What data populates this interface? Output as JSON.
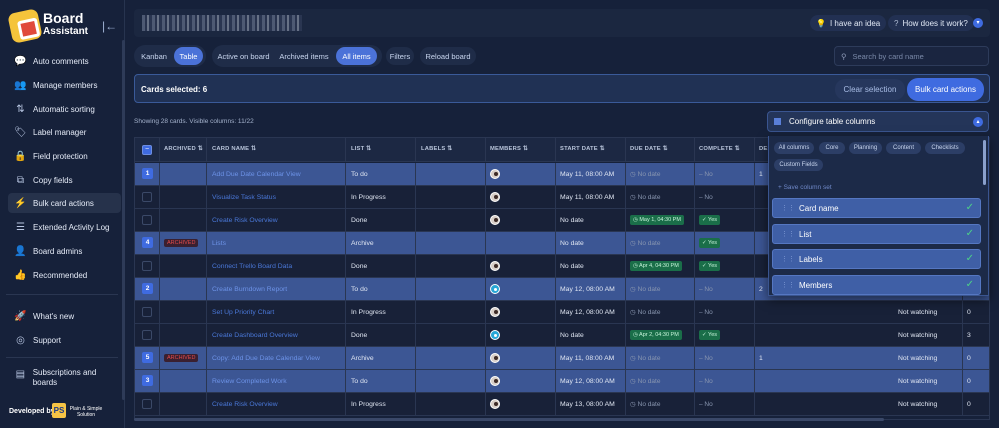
{
  "brand": {
    "name": "Board",
    "sub": "Assistant"
  },
  "sidebar": {
    "items": [
      {
        "label": "Auto comments",
        "icon": "chat-icon",
        "glyph": "💬"
      },
      {
        "label": "Manage members",
        "icon": "users-icon",
        "glyph": "👥"
      },
      {
        "label": "Automatic sorting",
        "icon": "sort-icon",
        "glyph": "⇅"
      },
      {
        "label": "Label manager",
        "icon": "label-icon",
        "glyph": "🏷"
      },
      {
        "label": "Field protection",
        "icon": "lock-icon",
        "glyph": "🔒"
      },
      {
        "label": "Copy fields",
        "icon": "copy-icon",
        "glyph": "⧉"
      },
      {
        "label": "Bulk card actions",
        "icon": "bulk-icon",
        "glyph": "⚡"
      },
      {
        "label": "Extended Activity Log",
        "icon": "log-icon",
        "glyph": "☰"
      },
      {
        "label": "Board admins",
        "icon": "admin-icon",
        "glyph": "👤"
      },
      {
        "label": "Recommended",
        "icon": "thumbs-up-icon",
        "glyph": "👍"
      }
    ],
    "secondary": [
      {
        "label": "What's new",
        "icon": "rocket-icon",
        "glyph": "🚀"
      },
      {
        "label": "Support",
        "icon": "support-icon",
        "glyph": "◎"
      }
    ],
    "subscriptions": {
      "label": "Subscriptions and boards",
      "icon": "subscription-icon",
      "glyph": "▤"
    },
    "developed_by": "Developed by",
    "ps_logo": "PS",
    "ps_name": "Plain & Simple Solution"
  },
  "topbar": {
    "idea_label": "I have an idea",
    "how_label": "How does it work?"
  },
  "toolbar": {
    "views": [
      "Kanban",
      "Table"
    ],
    "filters": [
      "Active on board",
      "Archived items",
      "All items"
    ],
    "filters_label": "Filters",
    "reload_label": "Reload board",
    "search_placeholder": "Search by card name"
  },
  "selection": {
    "count_label": "Cards selected: 6",
    "clear_label": "Clear selection",
    "bulk_label": "Bulk card actions"
  },
  "showing": "Showing 28 cards. Visible columns: 11/22",
  "configure": {
    "label": "Configure table columns",
    "tabs": [
      "All columns",
      "Core",
      "Planning",
      "Content",
      "Checklists",
      "Custom Fields"
    ],
    "save_label": "+ Save column set",
    "columns": [
      "Card name",
      "List",
      "Labels",
      "Members"
    ]
  },
  "table": {
    "headers": [
      "ARCHIVED",
      "CARD NAME",
      "LIST",
      "LABELS",
      "MEMBERS",
      "START DATE",
      "DUE DATE",
      "COMPLETE",
      "DES"
    ],
    "rows": [
      {
        "num": "1",
        "selected": true,
        "archived": "",
        "name": "Add Due Date Calendar View",
        "list": "To do",
        "member": "person",
        "start": "May 11, 08:00 AM",
        "due": "No date",
        "due_tag": false,
        "complete": "No",
        "extra": "1",
        "watch": "",
        "count": ""
      },
      {
        "num": "",
        "selected": false,
        "archived": "",
        "name": "Visualize Task Status",
        "list": "In Progress",
        "member": "person",
        "start": "May 11, 08:00 AM",
        "due": "No date",
        "due_tag": false,
        "complete": "No",
        "extra": "",
        "watch": "",
        "count": ""
      },
      {
        "num": "",
        "selected": false,
        "archived": "",
        "name": "Create Risk Overview",
        "list": "Done",
        "member": "person",
        "start": "No date",
        "due": "May 1, 04:30 PM",
        "due_tag": true,
        "complete": "Yes",
        "extra": "",
        "watch": "",
        "count": ""
      },
      {
        "num": "4",
        "selected": true,
        "archived": "ARCHIVED",
        "name": "Lists",
        "list": "Archive",
        "member": "",
        "start": "No date",
        "due": "No date",
        "due_tag": false,
        "complete": "Yes",
        "extra": "",
        "watch": "",
        "count": ""
      },
      {
        "num": "",
        "selected": false,
        "archived": "",
        "name": "Connect Trello Board Data",
        "list": "Done",
        "member": "person",
        "start": "No date",
        "due": "Apr 4, 04:30 PM",
        "due_tag": true,
        "complete": "Yes",
        "extra": "",
        "watch": "",
        "count": ""
      },
      {
        "num": "2",
        "selected": true,
        "archived": "",
        "name": "Create Burndown Report",
        "list": "To do",
        "member": "blue",
        "start": "May 12, 08:00 AM",
        "due": "No date",
        "due_tag": false,
        "complete": "No",
        "extra": "2",
        "watch": "",
        "count": ""
      },
      {
        "num": "",
        "selected": false,
        "archived": "",
        "name": "Set Up Priority Chart",
        "list": "In Progress",
        "member": "person",
        "start": "May 12, 08:00 AM",
        "due": "No date",
        "due_tag": false,
        "complete": "No",
        "extra": "",
        "watch": "Not watching",
        "count": "0"
      },
      {
        "num": "",
        "selected": false,
        "archived": "",
        "name": "Create Dashboard Overview",
        "list": "Done",
        "member": "blue",
        "start": "No date",
        "due": "Apr 2, 04:30 PM",
        "due_tag": true,
        "complete": "Yes",
        "extra": "",
        "watch": "Not watching",
        "count": "3"
      },
      {
        "num": "5",
        "selected": true,
        "archived": "ARCHIVED",
        "name": "Copy: Add Due Date Calendar View",
        "list": "Archive",
        "member": "person",
        "start": "May 11, 08:00 AM",
        "due": "No date",
        "due_tag": false,
        "complete": "No",
        "extra": "1",
        "watch": "Not watching",
        "count": "0"
      },
      {
        "num": "3",
        "selected": true,
        "archived": "",
        "name": "Review Completed Work",
        "list": "To do",
        "member": "person",
        "start": "May 12, 08:00 AM",
        "due": "No date",
        "due_tag": false,
        "complete": "No",
        "extra": "",
        "watch": "Not watching",
        "count": "0"
      },
      {
        "num": "",
        "selected": false,
        "archived": "",
        "name": "Create Risk Overview",
        "list": "In Progress",
        "member": "person",
        "start": "May 13, 08:00 AM",
        "due": "No date",
        "due_tag": false,
        "complete": "No",
        "extra": "",
        "watch": "Not watching",
        "count": "0"
      }
    ]
  }
}
